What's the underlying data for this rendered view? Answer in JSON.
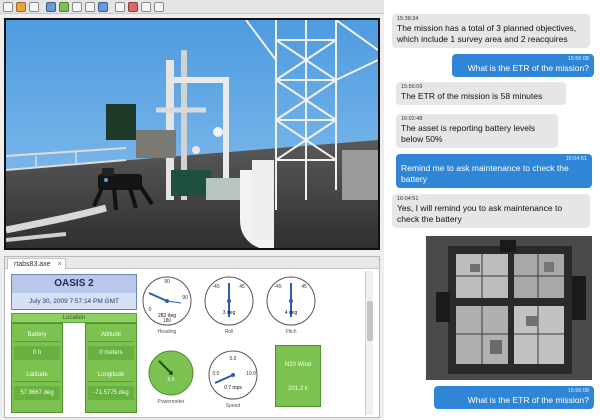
{
  "telemetry": {
    "tab_label": "rtabs83.axe",
    "mission_name": "OASIS 2",
    "mission_time": "July 30, 2009 7:57:14 PM GMT",
    "strip_label": "Location",
    "fields": [
      {
        "label": "Battery",
        "value": "0 h"
      },
      {
        "label": "Latitude",
        "value": "57.9667 deg"
      },
      {
        "label": "Altitude",
        "value": "0 meters"
      },
      {
        "label": "Longitude",
        "value": "-71.5775 deg"
      }
    ],
    "gauges": [
      {
        "name": "Heading",
        "top": "90",
        "left": "0",
        "bottom": "180",
        "readout": "282 deg"
      },
      {
        "name": "Roll",
        "top": "45",
        "left": "-45",
        "readout": "3 deg"
      },
      {
        "name": "Pitch",
        "top": "45",
        "left": "-45",
        "readout": "4 deg"
      },
      {
        "name": "Powermeter",
        "readout": "5.0"
      },
      {
        "name": "Speed",
        "top": "5.0",
        "left": "0.0",
        "right": "10.0",
        "readout": "0.7 mps"
      }
    ],
    "wind": {
      "line1": "N20 Wind",
      "line2": "201.2 k"
    },
    "colors": {
      "green": "#7cc250",
      "blue": "#b8c8ea"
    }
  },
  "chat": {
    "messages": [
      {
        "sender": "system",
        "time": "15:38:34",
        "text": "The mission has a total of 3 planned objectives, which include 1 survey area and 2 reacquires"
      },
      {
        "sender": "user",
        "time": "15:56:08",
        "text": "What is the ETR of the mission?"
      },
      {
        "sender": "system",
        "time": "15:56:09",
        "text": "The ETR of the mission is 58 minutes"
      },
      {
        "sender": "system",
        "time": "16:02:48",
        "text": "The asset is reporting battery levels below 50%"
      },
      {
        "sender": "user",
        "time": "16:04:51",
        "text": "Remind me to ask maintenance to check the battery"
      },
      {
        "sender": "system",
        "time": "16:04:51",
        "text": "Yes, I will remind you to ask maintenance to check the battery"
      },
      {
        "sender": "user",
        "time": "15:56:08",
        "text": "What is the ETR of the mission?"
      }
    ],
    "colors": {
      "user_bubble": "#2f86d6",
      "system_bubble": "#e6e6e6"
    }
  }
}
